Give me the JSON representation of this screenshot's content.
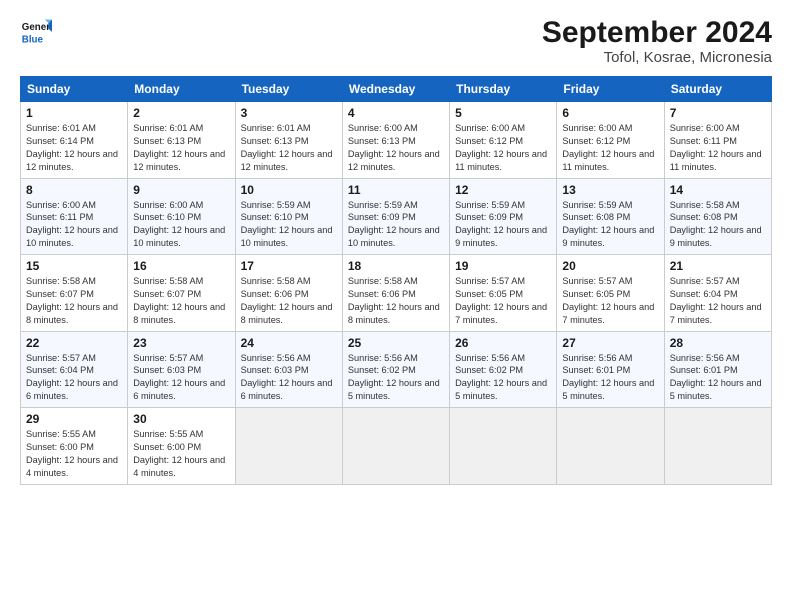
{
  "logo": {
    "line1": "General",
    "line2": "Blue"
  },
  "title": "September 2024",
  "subtitle": "Tofol, Kosrae, Micronesia",
  "days_header": [
    "Sunday",
    "Monday",
    "Tuesday",
    "Wednesday",
    "Thursday",
    "Friday",
    "Saturday"
  ],
  "weeks": [
    [
      {
        "num": "1",
        "info": "Sunrise: 6:01 AM\nSunset: 6:14 PM\nDaylight: 12 hours\nand 12 minutes."
      },
      {
        "num": "2",
        "info": "Sunrise: 6:01 AM\nSunset: 6:13 PM\nDaylight: 12 hours\nand 12 minutes."
      },
      {
        "num": "3",
        "info": "Sunrise: 6:01 AM\nSunset: 6:13 PM\nDaylight: 12 hours\nand 12 minutes."
      },
      {
        "num": "4",
        "info": "Sunrise: 6:00 AM\nSunset: 6:13 PM\nDaylight: 12 hours\nand 12 minutes."
      },
      {
        "num": "5",
        "info": "Sunrise: 6:00 AM\nSunset: 6:12 PM\nDaylight: 12 hours\nand 11 minutes."
      },
      {
        "num": "6",
        "info": "Sunrise: 6:00 AM\nSunset: 6:12 PM\nDaylight: 12 hours\nand 11 minutes."
      },
      {
        "num": "7",
        "info": "Sunrise: 6:00 AM\nSunset: 6:11 PM\nDaylight: 12 hours\nand 11 minutes."
      }
    ],
    [
      {
        "num": "8",
        "info": "Sunrise: 6:00 AM\nSunset: 6:11 PM\nDaylight: 12 hours\nand 10 minutes."
      },
      {
        "num": "9",
        "info": "Sunrise: 6:00 AM\nSunset: 6:10 PM\nDaylight: 12 hours\nand 10 minutes."
      },
      {
        "num": "10",
        "info": "Sunrise: 5:59 AM\nSunset: 6:10 PM\nDaylight: 12 hours\nand 10 minutes."
      },
      {
        "num": "11",
        "info": "Sunrise: 5:59 AM\nSunset: 6:09 PM\nDaylight: 12 hours\nand 10 minutes."
      },
      {
        "num": "12",
        "info": "Sunrise: 5:59 AM\nSunset: 6:09 PM\nDaylight: 12 hours\nand 9 minutes."
      },
      {
        "num": "13",
        "info": "Sunrise: 5:59 AM\nSunset: 6:08 PM\nDaylight: 12 hours\nand 9 minutes."
      },
      {
        "num": "14",
        "info": "Sunrise: 5:58 AM\nSunset: 6:08 PM\nDaylight: 12 hours\nand 9 minutes."
      }
    ],
    [
      {
        "num": "15",
        "info": "Sunrise: 5:58 AM\nSunset: 6:07 PM\nDaylight: 12 hours\nand 8 minutes."
      },
      {
        "num": "16",
        "info": "Sunrise: 5:58 AM\nSunset: 6:07 PM\nDaylight: 12 hours\nand 8 minutes."
      },
      {
        "num": "17",
        "info": "Sunrise: 5:58 AM\nSunset: 6:06 PM\nDaylight: 12 hours\nand 8 minutes."
      },
      {
        "num": "18",
        "info": "Sunrise: 5:58 AM\nSunset: 6:06 PM\nDaylight: 12 hours\nand 8 minutes."
      },
      {
        "num": "19",
        "info": "Sunrise: 5:57 AM\nSunset: 6:05 PM\nDaylight: 12 hours\nand 7 minutes."
      },
      {
        "num": "20",
        "info": "Sunrise: 5:57 AM\nSunset: 6:05 PM\nDaylight: 12 hours\nand 7 minutes."
      },
      {
        "num": "21",
        "info": "Sunrise: 5:57 AM\nSunset: 6:04 PM\nDaylight: 12 hours\nand 7 minutes."
      }
    ],
    [
      {
        "num": "22",
        "info": "Sunrise: 5:57 AM\nSunset: 6:04 PM\nDaylight: 12 hours\nand 6 minutes."
      },
      {
        "num": "23",
        "info": "Sunrise: 5:57 AM\nSunset: 6:03 PM\nDaylight: 12 hours\nand 6 minutes."
      },
      {
        "num": "24",
        "info": "Sunrise: 5:56 AM\nSunset: 6:03 PM\nDaylight: 12 hours\nand 6 minutes."
      },
      {
        "num": "25",
        "info": "Sunrise: 5:56 AM\nSunset: 6:02 PM\nDaylight: 12 hours\nand 5 minutes."
      },
      {
        "num": "26",
        "info": "Sunrise: 5:56 AM\nSunset: 6:02 PM\nDaylight: 12 hours\nand 5 minutes."
      },
      {
        "num": "27",
        "info": "Sunrise: 5:56 AM\nSunset: 6:01 PM\nDaylight: 12 hours\nand 5 minutes."
      },
      {
        "num": "28",
        "info": "Sunrise: 5:56 AM\nSunset: 6:01 PM\nDaylight: 12 hours\nand 5 minutes."
      }
    ],
    [
      {
        "num": "29",
        "info": "Sunrise: 5:55 AM\nSunset: 6:00 PM\nDaylight: 12 hours\nand 4 minutes."
      },
      {
        "num": "30",
        "info": "Sunrise: 5:55 AM\nSunset: 6:00 PM\nDaylight: 12 hours\nand 4 minutes."
      },
      {
        "num": "",
        "info": ""
      },
      {
        "num": "",
        "info": ""
      },
      {
        "num": "",
        "info": ""
      },
      {
        "num": "",
        "info": ""
      },
      {
        "num": "",
        "info": ""
      }
    ]
  ]
}
